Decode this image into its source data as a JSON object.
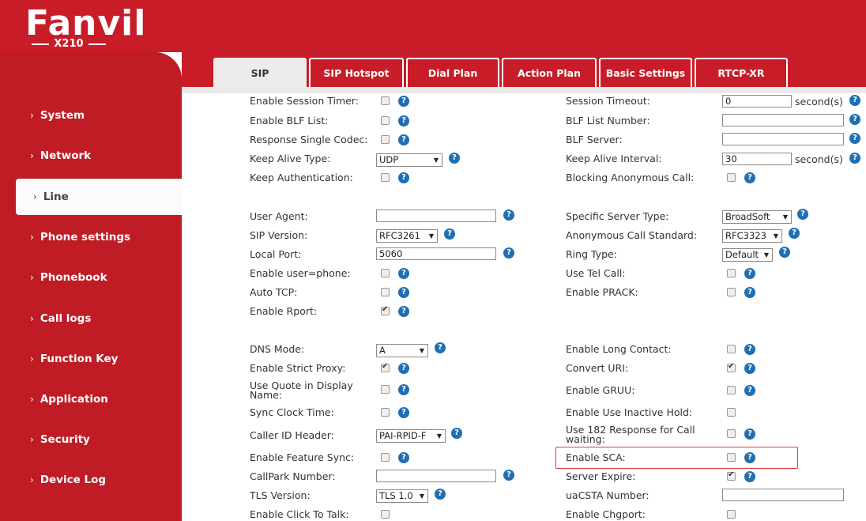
{
  "brand": {
    "name": "Fanvil",
    "model": "X210"
  },
  "tabs": [
    {
      "label": "SIP",
      "active": true
    },
    {
      "label": "SIP Hotspot"
    },
    {
      "label": "Dial Plan"
    },
    {
      "label": "Action Plan"
    },
    {
      "label": "Basic Settings"
    },
    {
      "label": "RTCP-XR"
    }
  ],
  "sidebar": {
    "items": [
      {
        "label": "System"
      },
      {
        "label": "Network"
      },
      {
        "label": "Line",
        "active": true
      },
      {
        "label": "Phone settings"
      },
      {
        "label": "Phonebook"
      },
      {
        "label": "Call logs"
      },
      {
        "label": "Function Key"
      },
      {
        "label": "Application"
      },
      {
        "label": "Security"
      },
      {
        "label": "Device Log"
      }
    ]
  },
  "help_glyph": "?",
  "chevron": "›",
  "left": {
    "enable_session_timer": {
      "label": "Enable Session Timer:",
      "checked": false
    },
    "enable_blf_list": {
      "label": "Enable BLF List:",
      "checked": false
    },
    "response_single_codec": {
      "label": "Response Single Codec:",
      "checked": false
    },
    "keep_alive_type": {
      "label": "Keep Alive Type:",
      "value": "UDP"
    },
    "keep_authentication": {
      "label": "Keep Authentication:",
      "checked": false
    },
    "user_agent": {
      "label": "User Agent:",
      "value": ""
    },
    "sip_version": {
      "label": "SIP Version:",
      "value": "RFC3261"
    },
    "local_port": {
      "label": "Local Port:",
      "value": "5060"
    },
    "enable_user_phone": {
      "label": "Enable user=phone:",
      "checked": false
    },
    "auto_tcp": {
      "label": "Auto TCP:",
      "checked": false
    },
    "enable_rport": {
      "label": "Enable Rport:",
      "checked": true
    },
    "dns_mode": {
      "label": "DNS Mode:",
      "value": "A"
    },
    "enable_strict_proxy": {
      "label": "Enable Strict Proxy:",
      "checked": true
    },
    "use_quote": {
      "label_line1": "Use Quote in Display",
      "label_line2": "Name:",
      "checked": false
    },
    "sync_clock_time": {
      "label": "Sync Clock Time:",
      "checked": false
    },
    "caller_id_header": {
      "label": "Caller ID Header:",
      "value": "PAI-RPID-F"
    },
    "enable_feature_sync": {
      "label": "Enable Feature Sync:",
      "checked": false
    },
    "callpark_number": {
      "label": "CallPark Number:",
      "value": ""
    },
    "tls_version": {
      "label": "TLS Version:",
      "value": "TLS 1.0"
    },
    "enable_click_to_talk": {
      "label": "Enable Click To Talk:",
      "checked": false
    }
  },
  "right": {
    "session_timeout": {
      "label": "Session Timeout:",
      "value": "0",
      "unit": "second(s)"
    },
    "blf_list_number": {
      "label": "BLF List Number:",
      "value": ""
    },
    "blf_server": {
      "label": "BLF Server:",
      "value": ""
    },
    "keep_alive_interval": {
      "label": "Keep Alive Interval:",
      "value": "30",
      "unit": "second(s)"
    },
    "blocking_anonymous_call": {
      "label": "Blocking Anonymous Call:",
      "checked": false
    },
    "specific_server_type": {
      "label": "Specific Server Type:",
      "value": "BroadSoft"
    },
    "anonymous_call_standard": {
      "label": "Anonymous Call Standard:",
      "value": "RFC3323"
    },
    "ring_type": {
      "label": "Ring Type:",
      "value": "Default"
    },
    "use_tel_call": {
      "label": "Use Tel Call:",
      "checked": false
    },
    "enable_prack": {
      "label": "Enable PRACK:",
      "checked": false
    },
    "enable_long_contact": {
      "label": "Enable Long Contact:",
      "checked": false
    },
    "convert_uri": {
      "label": "Convert URI:",
      "checked": true
    },
    "enable_gruu": {
      "label": "Enable GRUU:",
      "checked": false
    },
    "enable_use_inactive_hold": {
      "label": "Enable Use Inactive Hold:",
      "checked": false
    },
    "use_182_response": {
      "label_line1": "Use 182 Response for Call",
      "label_line2": "waiting:",
      "checked": false
    },
    "enable_sca": {
      "label": "Enable SCA:",
      "checked": false
    },
    "server_expire": {
      "label": "Server Expire:",
      "checked": true
    },
    "uacsta_number": {
      "label": "uaCSTA Number:",
      "value": ""
    },
    "enable_chgport": {
      "label": "Enable Chgport:",
      "checked": false
    }
  },
  "colors": {
    "brand_red": "#c81d29",
    "help_blue": "#1e6fb3",
    "highlight": "#e03b3b"
  }
}
